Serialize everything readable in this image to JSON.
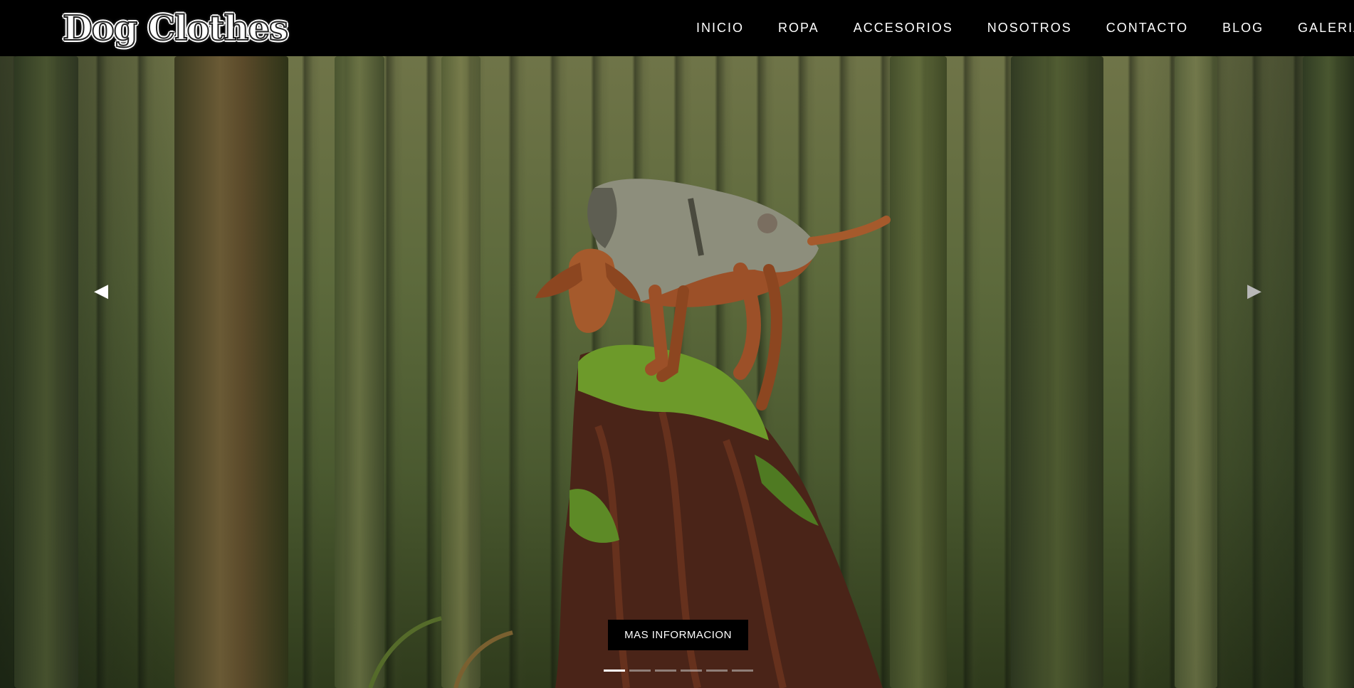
{
  "brand": {
    "logo_text": "Dog Clothes"
  },
  "nav": {
    "items": [
      {
        "label": "INICIO"
      },
      {
        "label": "ROPA"
      },
      {
        "label": "ACCESORIOS"
      },
      {
        "label": "NOSOTROS"
      },
      {
        "label": "CONTACTO"
      },
      {
        "label": "BLOG"
      },
      {
        "label": "GALERIA"
      }
    ]
  },
  "carousel": {
    "cta_label": "MAS INFORMACION",
    "prev_icon": "chevron-left-icon",
    "next_icon": "chevron-right-icon",
    "slide_count": 6,
    "active_slide": 1,
    "hero_image": "dog-in-coat-on-mossy-stump-in-forest"
  },
  "colors": {
    "navbar_bg": "#000000",
    "nav_text": "#ffffff",
    "cta_bg": "#000000",
    "forest_green": "#4b5a30"
  }
}
